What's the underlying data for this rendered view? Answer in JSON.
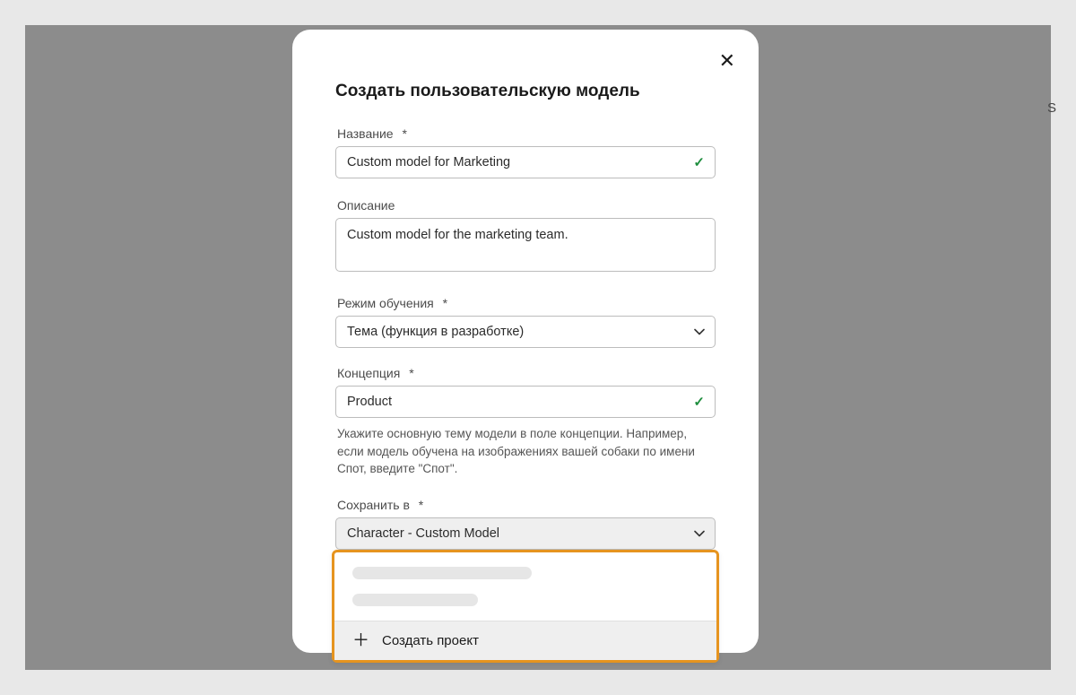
{
  "modal": {
    "title": "Создать пользовательскую модель",
    "close": "✕",
    "name": {
      "label": "Название",
      "asterisk": "*",
      "value": "Custom model for Marketing"
    },
    "description": {
      "label": "Описание",
      "value": "Custom model for the marketing team."
    },
    "training_mode": {
      "label": "Режим обучения",
      "asterisk": "*",
      "value": "Тема (функция в разработке)"
    },
    "concept": {
      "label": "Концепция",
      "asterisk": "*",
      "value": "Product",
      "help": "Укажите основную тему модели в поле концепции. Например, если модель обучена на изображениях вашей собаки по имени Спот, введите \"Спот\"."
    },
    "save_in": {
      "label": "Сохранить в",
      "asterisk": "*",
      "value": "Character - Custom Model"
    },
    "dropdown": {
      "create_project": "Создать проект"
    }
  },
  "side": {
    "s": "S"
  }
}
